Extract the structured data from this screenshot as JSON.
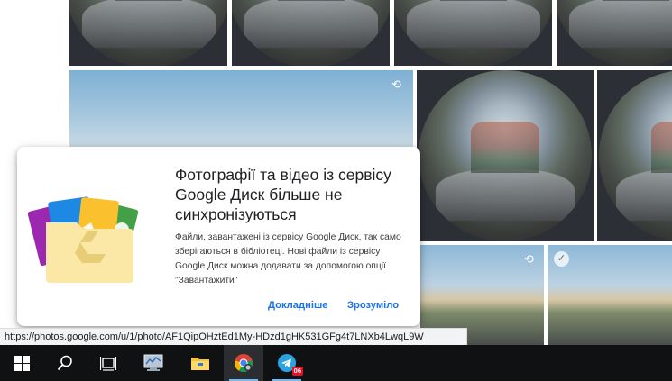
{
  "dialog": {
    "title": "Фотографії та відео із сервісу Google Диск більше не синхронізуються",
    "body": "Файли, завантажені із сервісу Google Диск, так само зберігаються в бібліотеці. Нові файли із сервісу Google Диск можна додавати за допомогою опції \"Завантажити\"",
    "learn_more": "Докладніше",
    "got_it": "Зрозуміло"
  },
  "statusbar": {
    "url": "https://photos.google.com/u/1/photo/AF1QipOHztEd1My-HDzd1gHK531GFg4t7LNXb4LwqL9W"
  },
  "taskbar": {
    "telegram_badge": "06"
  },
  "colors": {
    "accent": "#1a73e8",
    "taskbar": "#0f1113",
    "badge": "#e81123"
  }
}
